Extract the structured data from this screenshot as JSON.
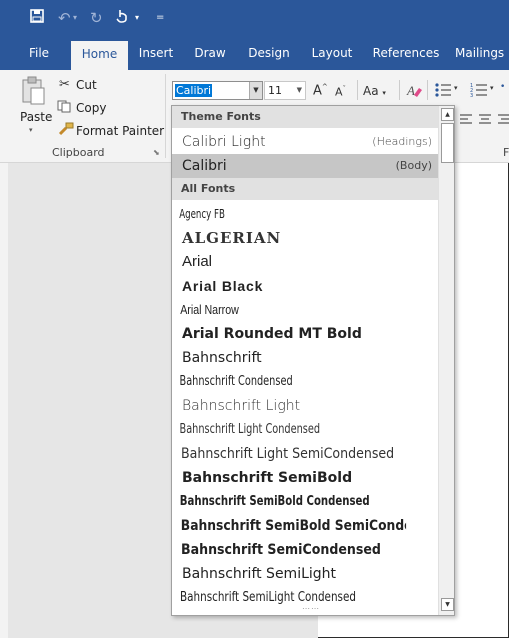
{
  "quick_access": {
    "save_icon": "save-icon",
    "undo_icon": "undo-icon",
    "redo_icon": "redo-icon",
    "touch_icon": "touch-mode-icon",
    "customize_icon": "customize-qat-icon"
  },
  "tabs": [
    {
      "label": "File"
    },
    {
      "label": "Home"
    },
    {
      "label": "Insert"
    },
    {
      "label": "Draw"
    },
    {
      "label": "Design"
    },
    {
      "label": "Layout"
    },
    {
      "label": "References"
    },
    {
      "label": "Mailings"
    }
  ],
  "clipboard": {
    "paste_label": "Paste",
    "cut_label": "Cut",
    "copy_label": "Copy",
    "format_painter_label": "Format Painter",
    "group_label": "Clipboard"
  },
  "font": {
    "current_font": "Calibri",
    "current_size": "11",
    "grow_label": "A",
    "shrink_label": "A",
    "case_label": "Aa"
  },
  "group_fragment": "F",
  "dropdown": {
    "theme_header": "Theme Fonts",
    "theme_fonts": [
      {
        "name": "Calibri Light",
        "hint": "(Headings)"
      },
      {
        "name": "Calibri",
        "hint": "(Body)"
      }
    ],
    "all_header": "All Fonts",
    "all_fonts": [
      "Agency FB",
      "ALGERIAN",
      "Arial",
      "Arial Black",
      "Arial Narrow",
      "Arial Rounded MT Bold",
      "Bahnschrift",
      "Bahnschrift Condensed",
      "Bahnschrift Light",
      "Bahnschrift Light Condensed",
      "Bahnschrift Light SemiCondensed",
      "Bahnschrift SemiBold",
      "Bahnschrift SemiBold Condensed",
      "Bahnschrift SemiBold SemiConden",
      "Bahnschrift SemiCondensed",
      "Bahnschrift SemiLight",
      "Bahnschrift SemiLight Condensed"
    ]
  },
  "colors": {
    "brand": "#2b579a",
    "selection": "#0078d7",
    "hover_item": "#c6c6c6"
  }
}
